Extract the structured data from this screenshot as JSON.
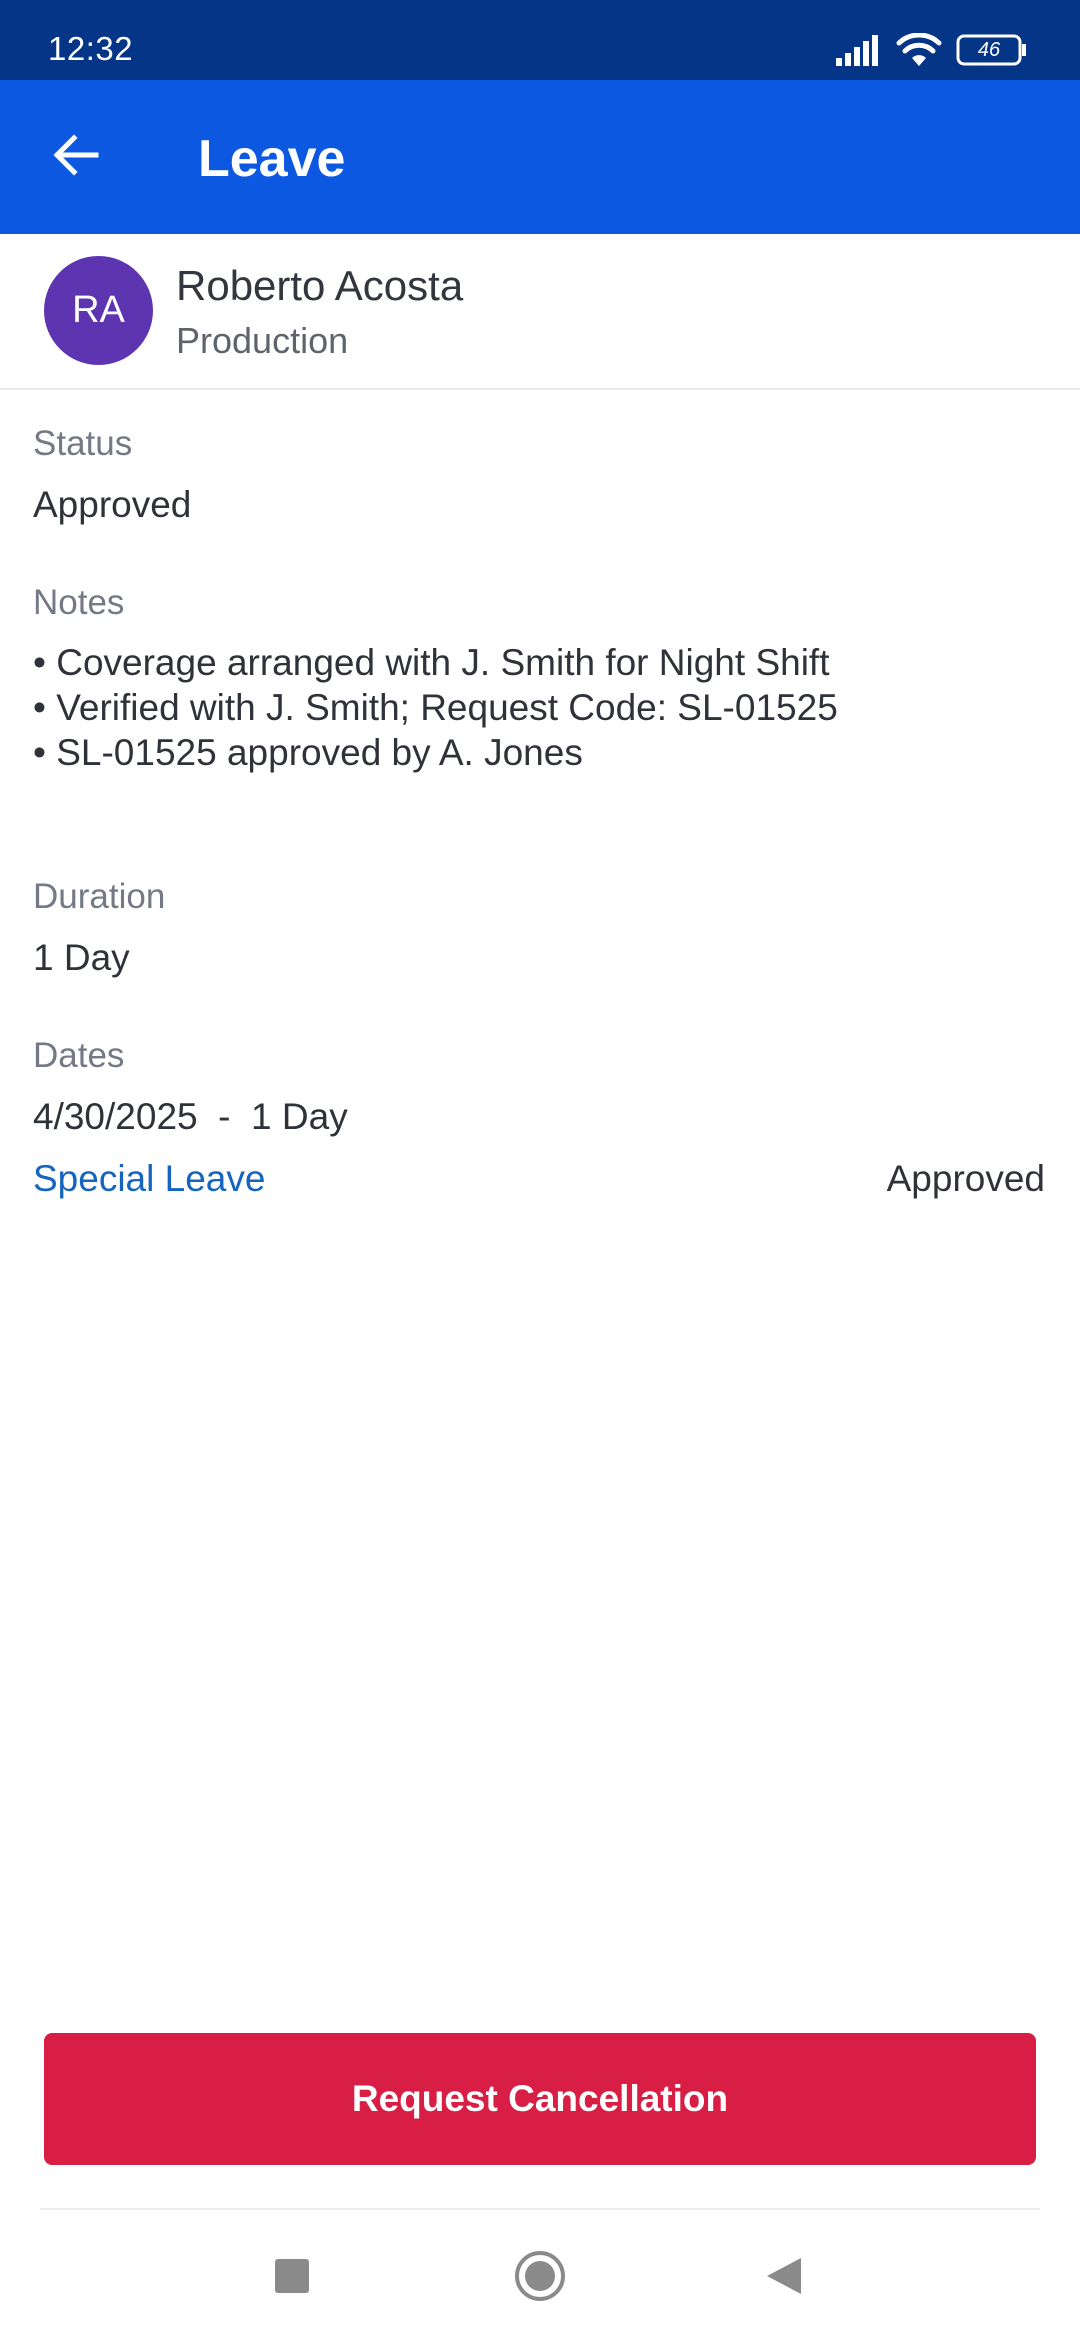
{
  "status_bar": {
    "time": "12:32",
    "battery": "46",
    "icons": [
      "signal-icon",
      "wifi-icon",
      "battery-icon"
    ]
  },
  "app_bar": {
    "title": "Leave",
    "back_icon": "arrow-left-icon"
  },
  "profile": {
    "initials": "RA",
    "name": "Roberto Acosta",
    "department": "Production",
    "avatar_color": "#5e35b1"
  },
  "details": {
    "status_label": "Status",
    "status_value": "Approved",
    "notes_label": "Notes",
    "notes": [
      "Coverage arranged with J. Smith for Night Shift",
      "Verified with J. Smith; Request Code: SL-01525",
      "SL-01525 approved by A. Jones"
    ],
    "duration_label": "Duration",
    "duration_value": "1 Day",
    "dates_label": "Dates",
    "dates_value": "4/30/2025  -  1 Day",
    "leave_type": "Special Leave",
    "leave_status": "Approved"
  },
  "actions": {
    "cancel_label": "Request Cancellation",
    "cancel_color": "#d81e45"
  },
  "nav": {
    "icons": [
      "recents-square-icon",
      "home-circle-icon",
      "back-triangle-icon"
    ]
  },
  "colors": {
    "status_bar": "#053586",
    "app_bar": "#0d58e0",
    "link": "#1565c0"
  }
}
